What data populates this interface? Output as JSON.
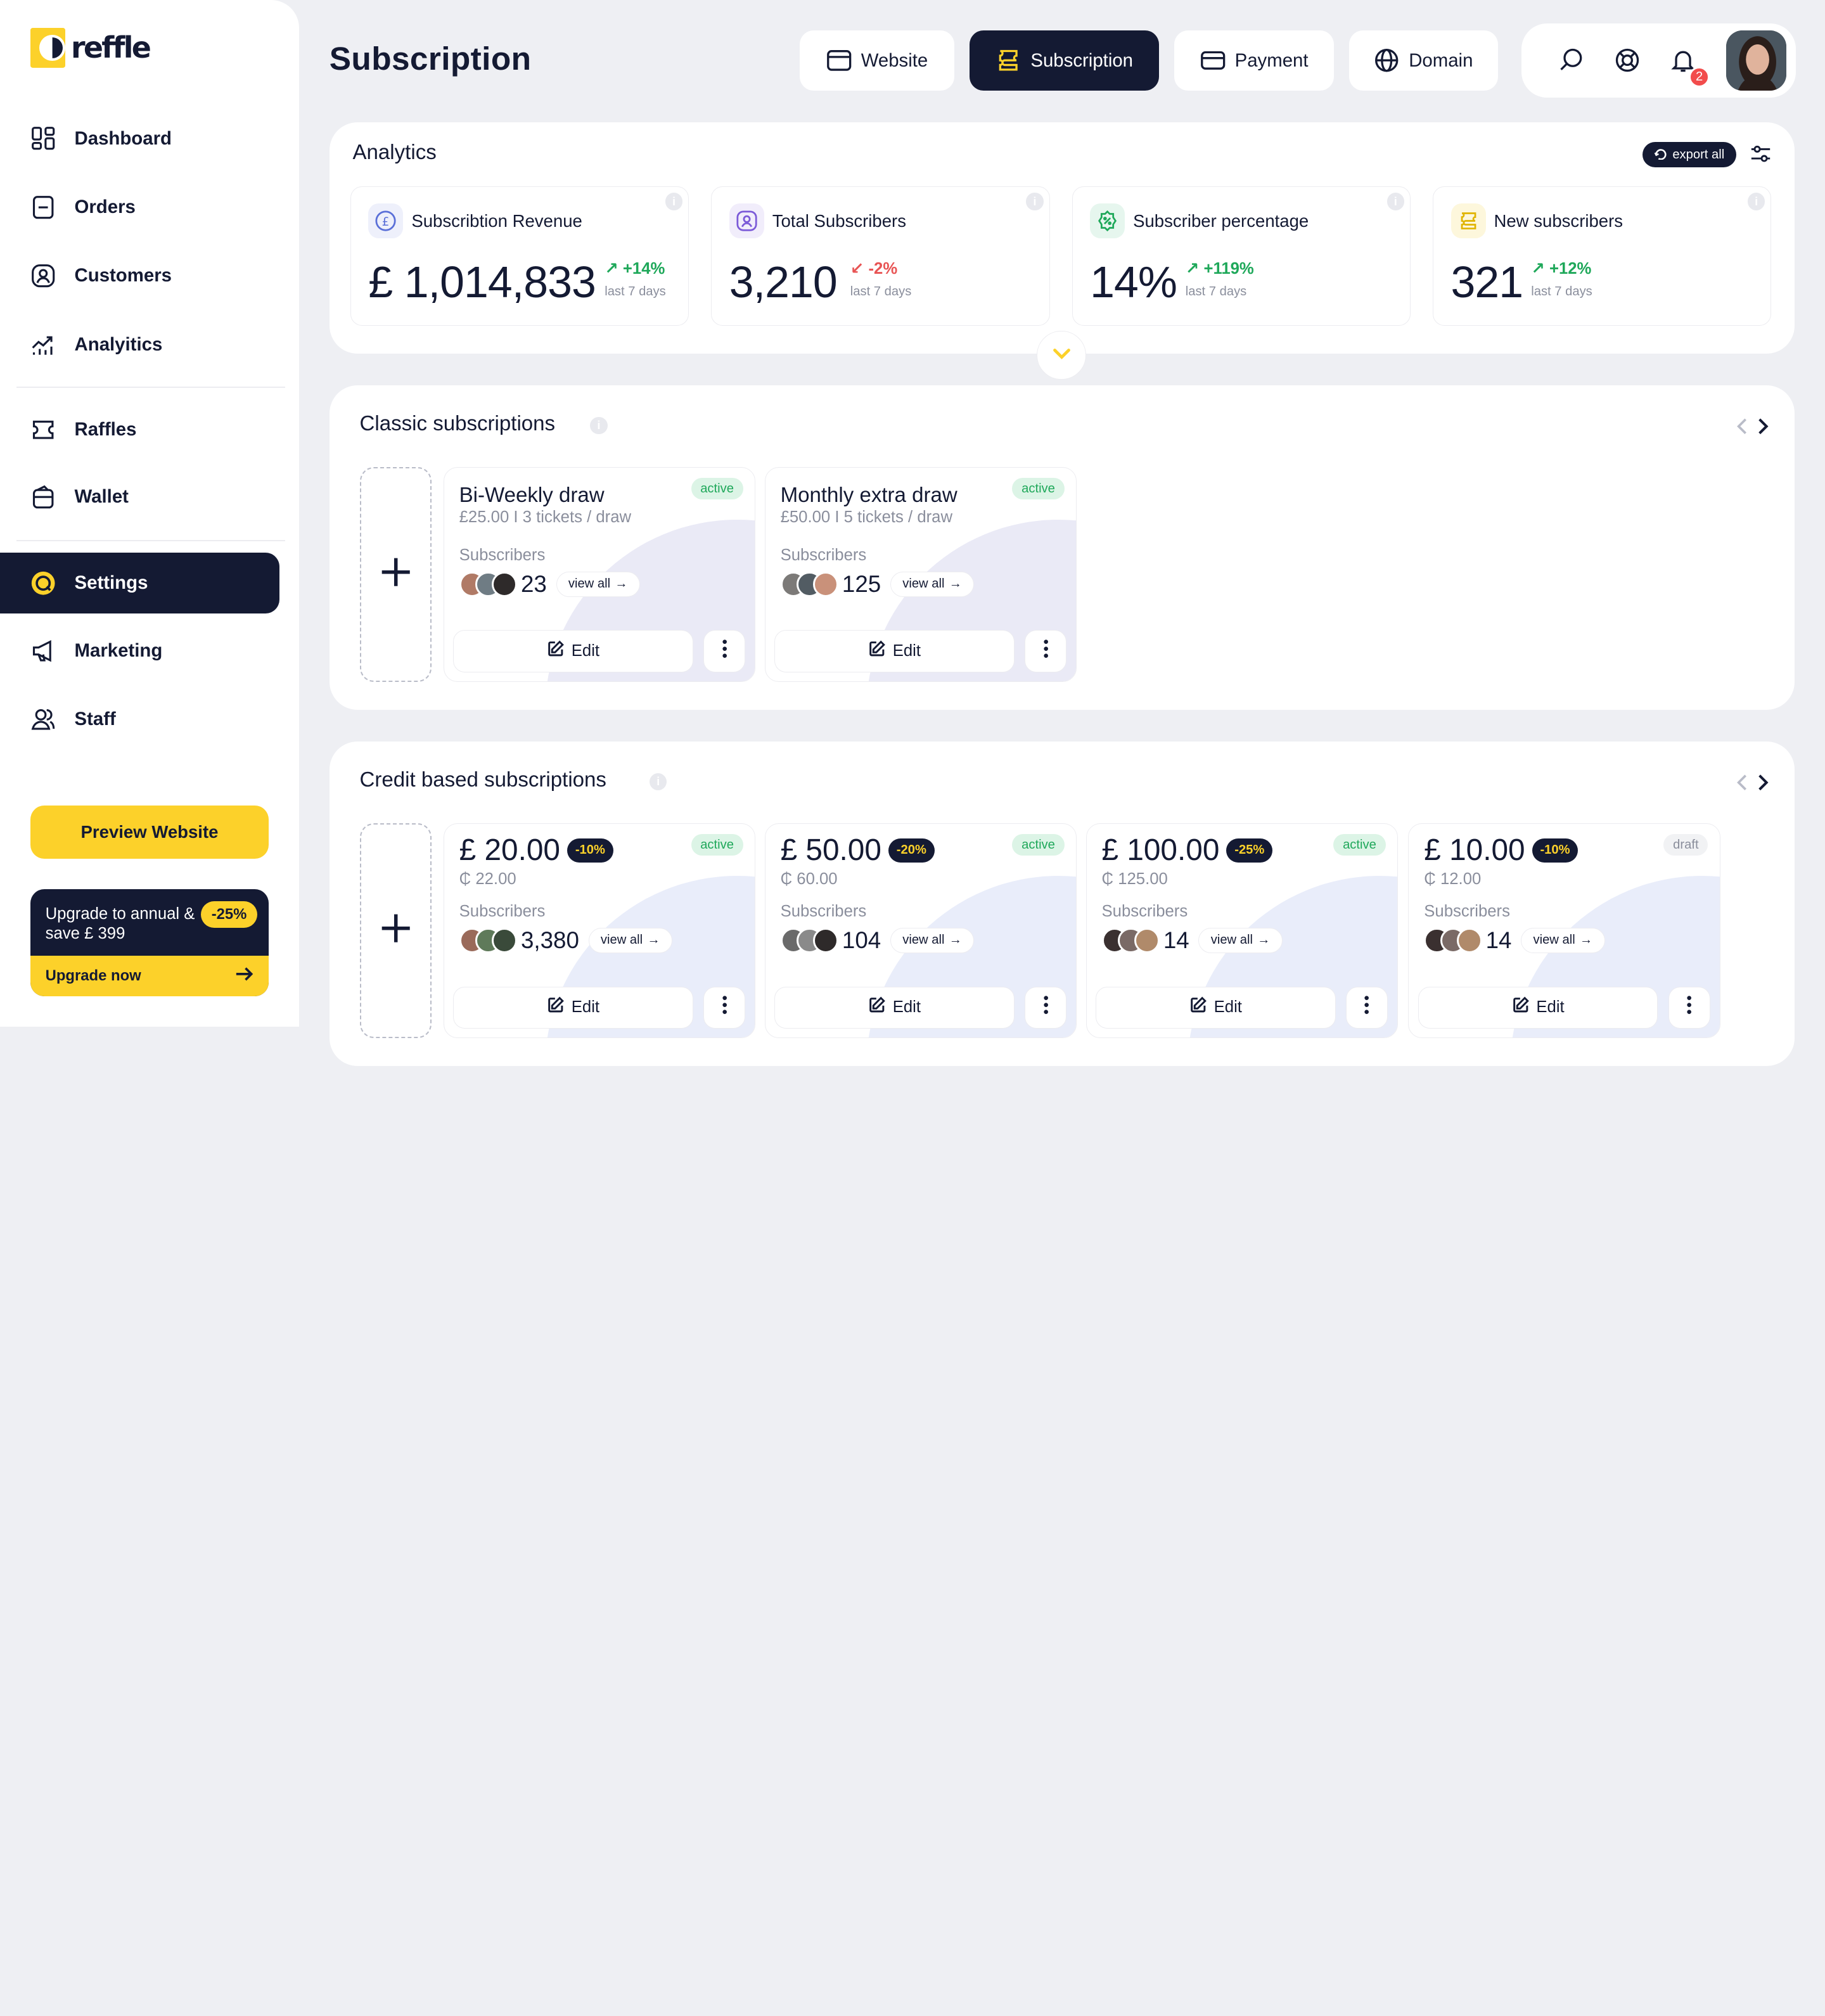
{
  "brand": {
    "name": "reffle",
    "accent": "#fcd12a",
    "dark": "#141a33"
  },
  "sidebar": {
    "items": [
      {
        "label": "Dashboard",
        "icon": "dashboard-icon"
      },
      {
        "label": "Orders",
        "icon": "orders-icon"
      },
      {
        "label": "Customers",
        "icon": "customers-icon"
      },
      {
        "label": "Analyitics",
        "icon": "analytics-icon"
      },
      {
        "label": "Raffles",
        "icon": "ticket-icon"
      },
      {
        "label": "Wallet",
        "icon": "wallet-icon"
      },
      {
        "label": "Settings",
        "icon": "settings-icon",
        "active": true
      },
      {
        "label": "Marketing",
        "icon": "megaphone-icon"
      },
      {
        "label": "Staff",
        "icon": "staff-icon"
      }
    ],
    "preview_label": "Preview Website",
    "upgrade": {
      "text": "Upgrade to annual & save £ 399",
      "badge": "-25%",
      "cta": "Upgrade now"
    }
  },
  "header": {
    "title": "Subscription",
    "tabs": [
      {
        "label": "Website",
        "icon": "window-icon"
      },
      {
        "label": "Subscription",
        "icon": "subscription-icon",
        "active": true
      },
      {
        "label": "Payment",
        "icon": "card-icon"
      },
      {
        "label": "Domain",
        "icon": "globe-icon"
      }
    ],
    "notifications": "2"
  },
  "analytics": {
    "title": "Analytics",
    "export_label": "export all",
    "cards": [
      {
        "title": "Subscribtion Revenue",
        "value": "£ 1,014,833",
        "change": "+14%",
        "direction": "up",
        "period": "last 7 days",
        "icon": "pound-icon",
        "icon_color": "#5a6fd8"
      },
      {
        "title": "Total Subscribers",
        "value": "3,210",
        "change": "-2%",
        "direction": "down",
        "period": "last 7 days",
        "icon": "user-icon",
        "icon_color": "#7b5ad8"
      },
      {
        "title": "Subscriber percentage",
        "value": "14%",
        "change": "+119%",
        "direction": "up",
        "period": "last 7 days",
        "icon": "percent-icon",
        "icon_color": "#1fa85a"
      },
      {
        "title": "New subscribers",
        "value": "321",
        "change": "+12%",
        "direction": "up",
        "period": "last 7 days",
        "icon": "subscription-icon",
        "icon_color": "#e0b400"
      }
    ]
  },
  "classic": {
    "title": "Classic subscriptions",
    "items": [
      {
        "name": "Bi-Weekly draw",
        "meta": "£25.00 I 3 tickets / draw",
        "status": "active",
        "subscribers_label": "Subscribers",
        "count": "23",
        "view_all": "view all",
        "edit": "Edit"
      },
      {
        "name": "Monthly extra draw",
        "meta": "£50.00 I 5 tickets / draw",
        "status": "active",
        "subscribers_label": "Subscribers",
        "count": "125",
        "view_all": "view all",
        "edit": "Edit"
      }
    ]
  },
  "credit": {
    "title": "Credit based subscriptions",
    "items": [
      {
        "price": "£ 20.00",
        "discount": "-10%",
        "coins": "₵ 22.00",
        "status": "active",
        "subscribers_label": "Subscribers",
        "count": "3,380",
        "view_all": "view all",
        "edit": "Edit"
      },
      {
        "price": "£ 50.00",
        "discount": "-20%",
        "coins": "₵ 60.00",
        "status": "active",
        "subscribers_label": "Subscribers",
        "count": "104",
        "view_all": "view all",
        "edit": "Edit"
      },
      {
        "price": "£ 100.00",
        "discount": "-25%",
        "coins": "₵ 125.00",
        "status": "active",
        "subscribers_label": "Subscribers",
        "count": "14",
        "view_all": "view all",
        "edit": "Edit"
      },
      {
        "price": "£ 10.00",
        "discount": "-10%",
        "coins": "₵ 12.00",
        "status": "draft",
        "subscribers_label": "Subscribers",
        "count": "14",
        "view_all": "view all",
        "edit": "Edit"
      }
    ]
  }
}
